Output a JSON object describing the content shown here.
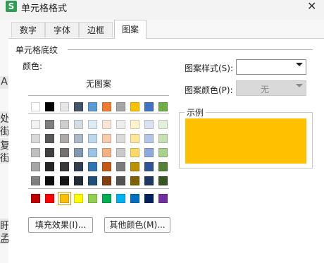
{
  "window": {
    "title": "单元格格式",
    "app_icon": "S"
  },
  "background": {
    "left_chars": [
      "A",
      "处",
      "街",
      "复",
      "街",
      "盱",
      "孟"
    ]
  },
  "tabs": [
    {
      "label": "数字"
    },
    {
      "label": "字体"
    },
    {
      "label": "边框"
    },
    {
      "label": "图案"
    }
  ],
  "active_tab": "图案",
  "section": {
    "title": "单元格底纹"
  },
  "color": {
    "label": "颜色:",
    "no_pattern": "无图案",
    "selected": "#FFC000",
    "rows": [
      [
        "#FFFFFF",
        "#000000",
        "#E7E6E6",
        "#44546A",
        "#5B9BD5",
        "#ED7D31",
        "#A5A5A5",
        "#FFC000",
        "#4472C4",
        "#70AD47"
      ],
      [
        "#F2F2F2",
        "#7F7F7F",
        "#D0CECE",
        "#D6DCE4",
        "#DDEBF7",
        "#FBE5D6",
        "#EDEDED",
        "#FFF2CC",
        "#D9E1F2",
        "#E2EFDA"
      ],
      [
        "#D9D9D9",
        "#595959",
        "#AEAAAA",
        "#ADB9CA",
        "#BDD7EE",
        "#F8CBAD",
        "#DBDBDB",
        "#FFE699",
        "#B4C6E7",
        "#C6E0B4"
      ],
      [
        "#BFBFBF",
        "#404040",
        "#757171",
        "#8497B0",
        "#9BC2E6",
        "#F4B084",
        "#C9C9C9",
        "#FFD966",
        "#8EA9DB",
        "#A9D08E"
      ],
      [
        "#A6A6A6",
        "#262626",
        "#3A3838",
        "#333F4F",
        "#2F75B5",
        "#C65911",
        "#7B7B7B",
        "#BF8F00",
        "#305496",
        "#548235"
      ],
      [
        "#808080",
        "#0D0D0D",
        "#161616",
        "#222B35",
        "#1F4E78",
        "#833C0B",
        "#525252",
        "#7F6000",
        "#203764",
        "#375623"
      ],
      [
        "#C00000",
        "#FF0000",
        "#FFC000",
        "#FFFF00",
        "#92D050",
        "#00B050",
        "#00B0F0",
        "#0070C0",
        "#002060",
        "#7030A0"
      ]
    ]
  },
  "buttons": {
    "fill_effects": "填充效果(I)...",
    "more_colors": "其他颜色(M)..."
  },
  "pattern_style": {
    "label": "图案样式(S):",
    "value": ""
  },
  "pattern_color": {
    "label": "图案颜色(P):",
    "value": "无"
  },
  "example": {
    "label": "示例",
    "color": "#FFC000"
  }
}
